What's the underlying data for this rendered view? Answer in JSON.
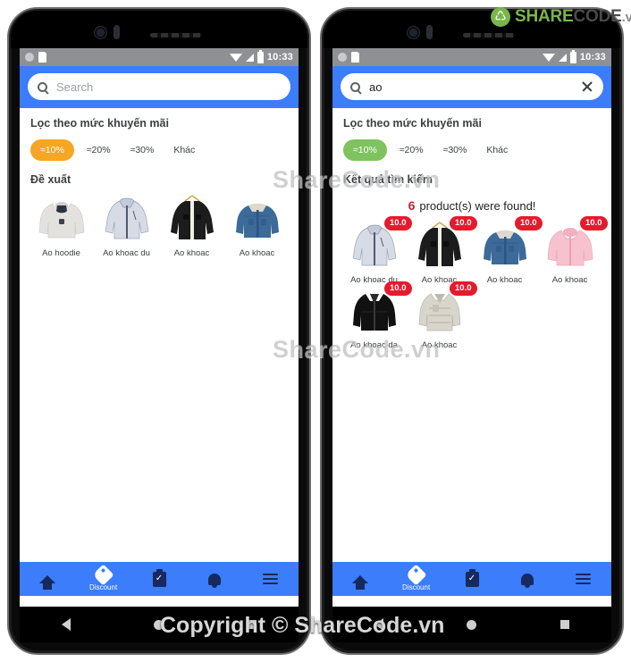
{
  "watermarks": {
    "overlay_1": "ShareCode.vn",
    "overlay_2": "ShareCode.vn",
    "copyright": "Copyright © ShareCode.vn"
  },
  "logo": {
    "share": "SHARE",
    "code": "CODE",
    "vn": ".vn"
  },
  "colors": {
    "accent_blue": "#3b7dfa",
    "chip_orange": "#f5a623",
    "chip_green": "#7fc260",
    "badge_red": "#e8192c",
    "statusbar_gray": "#8f9094"
  },
  "status_bar": {
    "time": "10:33",
    "icons": [
      "wifi-icon",
      "signal-icon",
      "battery-icon"
    ]
  },
  "bottom_nav": {
    "items": [
      {
        "name": "home",
        "label": "",
        "icon": "home-icon"
      },
      {
        "name": "discount",
        "label": "Discount",
        "icon": "discount-tag-icon"
      },
      {
        "name": "orders",
        "label": "",
        "icon": "clipboard-check-icon"
      },
      {
        "name": "notifications",
        "label": "",
        "icon": "bell-icon"
      },
      {
        "name": "menu",
        "label": "",
        "icon": "hamburger-menu-icon"
      }
    ]
  },
  "android_nav": {
    "back": "back-triangle-icon",
    "home": "home-circle-icon",
    "recents": "recents-square-icon"
  },
  "phone_left": {
    "search": {
      "value": "",
      "placeholder": "Search",
      "has_clear": false
    },
    "filter_title": "Lọc theo mức khuyến mãi",
    "chips": [
      {
        "label": "≈10%",
        "active": true,
        "color": "#f5a623"
      },
      {
        "label": "≈20%",
        "active": false
      },
      {
        "label": "≈30%",
        "active": false
      },
      {
        "label": "Khác",
        "active": false
      }
    ],
    "section_title": "Đề xuất",
    "products": [
      {
        "name": "Ao hoodie",
        "badge": null,
        "kind": "hoodie-gray"
      },
      {
        "name": "Ao khoac du",
        "badge": null,
        "kind": "windbreaker-lightblue"
      },
      {
        "name": "Ao khoac",
        "badge": null,
        "kind": "jacket-black-hanger"
      },
      {
        "name": "Ao khoac",
        "badge": null,
        "kind": "denim-sherpa"
      }
    ]
  },
  "phone_right": {
    "search": {
      "value": "ao",
      "placeholder": "Search",
      "has_clear": true
    },
    "filter_title": "Lọc theo mức khuyến mãi",
    "chips": [
      {
        "label": "≈10%",
        "active": true,
        "color": "#7fc260"
      },
      {
        "label": "≈20%",
        "active": false
      },
      {
        "label": "≈30%",
        "active": false
      },
      {
        "label": "Khác",
        "active": false
      }
    ],
    "section_title": "Kết quả tìm kiếm",
    "result_count": "6",
    "result_text": "product(s) were found!",
    "products": [
      {
        "name": "Ao khoac du",
        "badge": "10.0",
        "kind": "windbreaker-lightblue"
      },
      {
        "name": "Ao khoac",
        "badge": "10.0",
        "kind": "jacket-black-hanger"
      },
      {
        "name": "Ao khoac",
        "badge": "10.0",
        "kind": "denim-sherpa"
      },
      {
        "name": "Ao khoac",
        "badge": "10.0",
        "kind": "hoodie-pink"
      },
      {
        "name": "Ao khoac da",
        "badge": "10.0",
        "kind": "leather-black"
      },
      {
        "name": "Ao khoac",
        "badge": "10.0",
        "kind": "varsity-gray"
      }
    ]
  }
}
